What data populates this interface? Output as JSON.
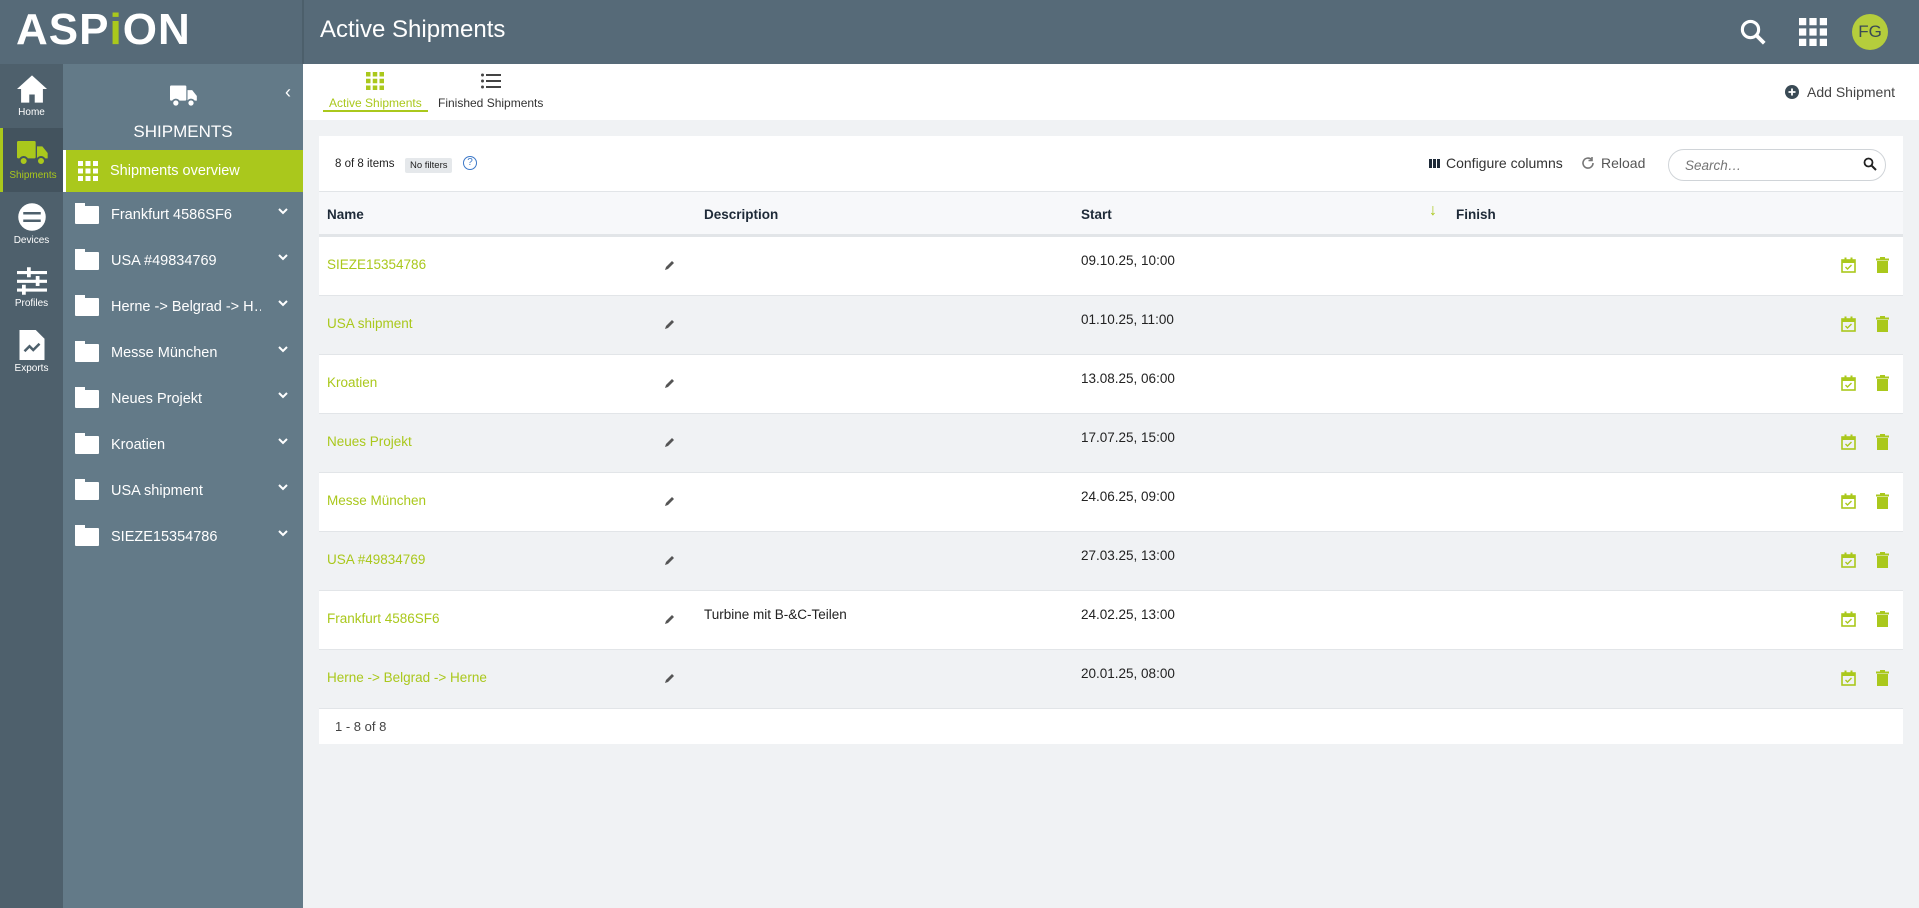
{
  "app": {
    "logo": "ASPiON",
    "page_title": "Active Shipments",
    "avatar_initials": "FG"
  },
  "rail": [
    {
      "label": "Home",
      "icon": "home-icon"
    },
    {
      "label": "Shipments",
      "icon": "truck-icon",
      "active": true
    },
    {
      "label": "Devices",
      "icon": "devices-icon"
    },
    {
      "label": "Profiles",
      "icon": "sliders-icon"
    },
    {
      "label": "Exports",
      "icon": "export-icon"
    }
  ],
  "sidebar": {
    "title": "SHIPMENTS",
    "overview": "Shipments overview",
    "items": [
      "Frankfurt 4586SF6",
      "USA #49834769",
      "Herne -> Belgrad -> H…",
      "Messe München",
      "Neues Projekt",
      "Kroatien",
      "USA shipment",
      "SIEZE15354786"
    ]
  },
  "tabs": [
    {
      "label": "Active Shipments",
      "active": true
    },
    {
      "label": "Finished Shipments"
    }
  ],
  "add_shipment": "Add Shipment",
  "toolbar": {
    "count": "8 of 8 items",
    "filters": "No filters",
    "configure": "Configure columns",
    "reload": "Reload",
    "search_placeholder": "Search…"
  },
  "columns": {
    "name": "Name",
    "description": "Description",
    "start": "Start",
    "finish": "Finish",
    "sort": "Start descending"
  },
  "rows": [
    {
      "name": "SIEZE15354786",
      "description": "",
      "start": "09.10.25, 10:00",
      "finish": ""
    },
    {
      "name": "USA shipment",
      "description": "",
      "start": "01.10.25, 11:00",
      "finish": ""
    },
    {
      "name": "Kroatien",
      "description": "",
      "start": "13.08.25, 06:00",
      "finish": ""
    },
    {
      "name": "Neues Projekt",
      "description": "",
      "start": "17.07.25, 15:00",
      "finish": ""
    },
    {
      "name": "Messe München",
      "description": "",
      "start": "24.06.25, 09:00",
      "finish": ""
    },
    {
      "name": "USA #49834769",
      "description": "",
      "start": "27.03.25, 13:00",
      "finish": ""
    },
    {
      "name": "Frankfurt 4586SF6",
      "description": "Turbine mit B-&C-Teilen",
      "start": "24.02.25, 13:00",
      "finish": ""
    },
    {
      "name": "Herne -> Belgrad -> Herne",
      "description": "",
      "start": "20.01.25, 08:00",
      "finish": ""
    }
  ],
  "pagination": "1 - 8 of 8",
  "colors": {
    "accent": "#aac81c",
    "topbar": "#566a78",
    "sidebar": "#637a88",
    "rail": "#4e606c"
  }
}
